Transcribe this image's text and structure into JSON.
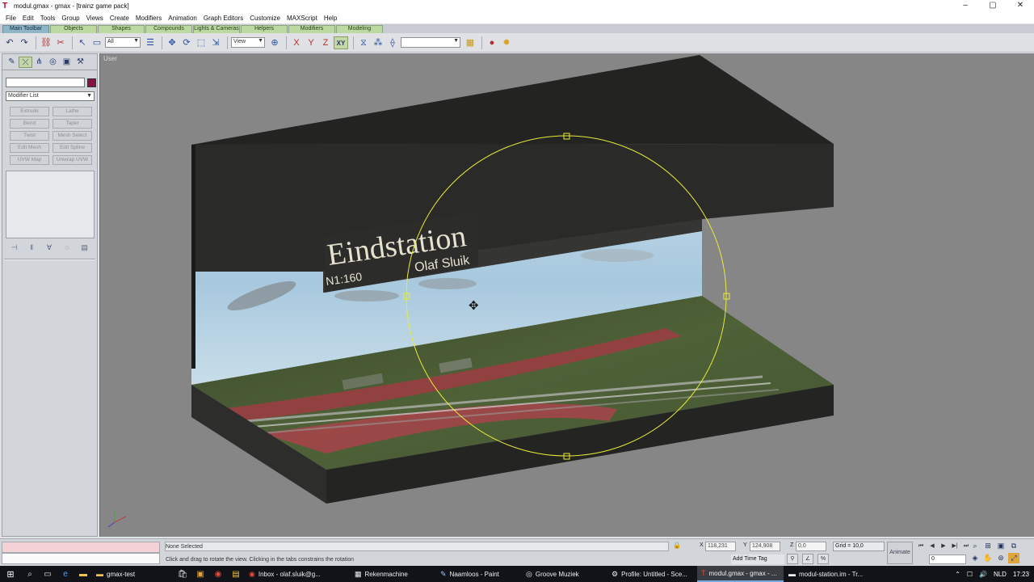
{
  "window": {
    "title": "modul.gmax - gmax - [trainz game pack]",
    "controls": [
      "–",
      "▢",
      "✕"
    ]
  },
  "menu": [
    "File",
    "Edit",
    "Tools",
    "Group",
    "Views",
    "Create",
    "Modifiers",
    "Animation",
    "Graph Editors",
    "Customize",
    "MAXScript",
    "Help"
  ],
  "tabs": [
    "Main Toolbar",
    "Objects",
    "Shapes",
    "Compounds",
    "Lights & Cameras",
    "Helpers",
    "Modifiers",
    "Modeling"
  ],
  "toolbar": {
    "selection_filter": "All",
    "reference_coord": "View",
    "constraint_xy": "XY",
    "named_selection": ""
  },
  "command_panel": {
    "modifier_list": "Modifier List",
    "modifier_buttons": [
      "Extrude",
      "Lathe",
      "Bend",
      "Taper",
      "Twist",
      "Mesh Select",
      "Edit Mesh",
      "Edit Spline",
      "UVW Map",
      "Unwrap UVW"
    ],
    "accent_color": "#8a0e47"
  },
  "viewport": {
    "label": "User",
    "sign": {
      "title": "Eindstation",
      "author": "Olaf Sluik",
      "scale": "N1:160"
    },
    "gizmo_color": "#e8ea3a"
  },
  "status": {
    "selection": "None Selected",
    "prompt": "Click and drag to rotate the view. Clicking in the tabs constrains the rotation",
    "x_label": "X",
    "x_value": "118,231",
    "y_label": "Y",
    "y_value": "124,908",
    "z_label": "Z",
    "z_value": "0,0",
    "grid": "Grid = 10,0",
    "add_time_tag": "Add Time Tag",
    "animate": "Animate",
    "frame": "0"
  },
  "taskbar": {
    "items": [
      {
        "label": "gmax-test",
        "icon": "folder-icon",
        "active": false
      },
      {
        "label": "Inbox - olaf.sluik@g...",
        "icon": "mail-icon",
        "active": false
      },
      {
        "label": "Rekenmachine",
        "icon": "calculator-icon",
        "active": false
      },
      {
        "label": "Naamloos - Paint",
        "icon": "paint-icon",
        "active": false
      },
      {
        "label": "Groove Muziek",
        "icon": "music-icon",
        "active": false
      },
      {
        "label": "Profile: Untitled - Sce...",
        "icon": "profile-icon",
        "active": false
      },
      {
        "label": "modul.gmax - gmax - ...",
        "icon": "gmax-icon",
        "active": true
      },
      {
        "label": "modul-station.im - Tr...",
        "icon": "trainz-icon",
        "active": false
      }
    ],
    "language": "NLD",
    "time": "17:23"
  }
}
